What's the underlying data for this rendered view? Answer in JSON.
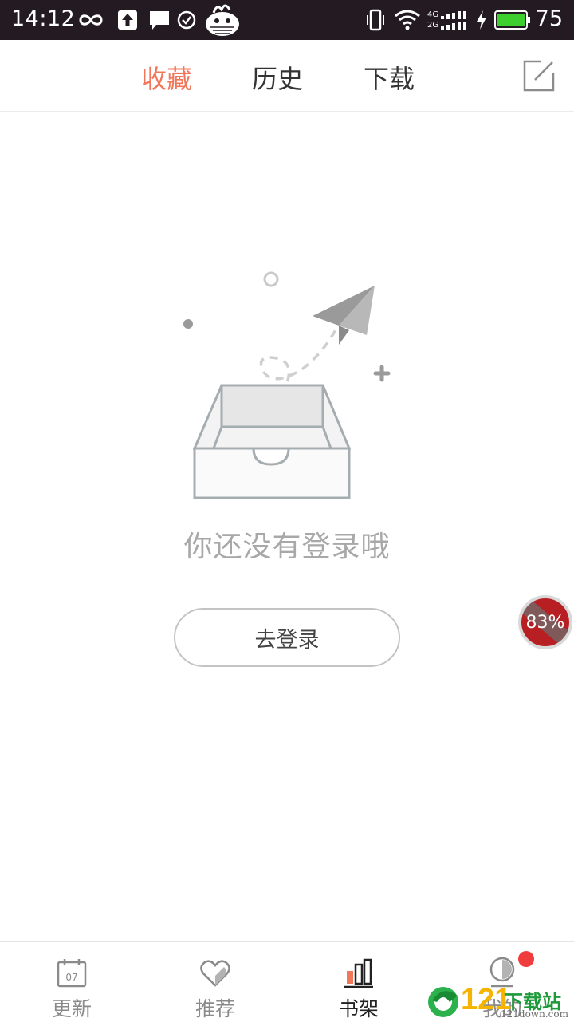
{
  "status_bar": {
    "time": "14:12",
    "network_top": "4G",
    "network_bottom": "2G",
    "battery_level": "75"
  },
  "top_tabs": [
    {
      "label": "收藏",
      "active": true
    },
    {
      "label": "历史",
      "active": false
    },
    {
      "label": "下载",
      "active": false
    }
  ],
  "empty_state": {
    "message": "你还没有登录哦",
    "login_button_label": "去登录"
  },
  "floating_badge": {
    "percent": "83%"
  },
  "bottom_nav": [
    {
      "label": "更新",
      "icon": "calendar-icon",
      "icon_text": "07",
      "active": false
    },
    {
      "label": "推荐",
      "icon": "heart-icon",
      "active": false
    },
    {
      "label": "书架",
      "icon": "bookshelf-icon",
      "active": true
    },
    {
      "label": "我的",
      "icon": "profile-icon",
      "active": false,
      "has_notification_dot": true
    }
  ],
  "watermark": {
    "number": "121",
    "text": "下载站",
    "url": "121down.com"
  },
  "colors": {
    "accent": "#f1775a",
    "status_bar_bg": "#231a22",
    "badge_red": "#b81f22",
    "notification_dot": "#f03c3c",
    "battery_green": "#3ccf2e"
  }
}
